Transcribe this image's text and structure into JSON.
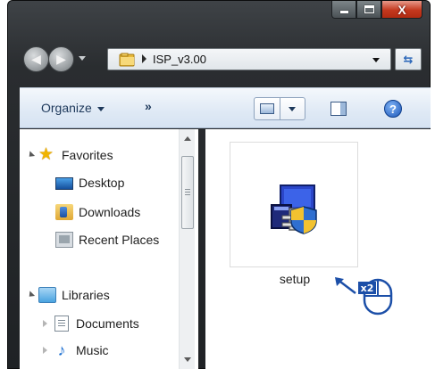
{
  "window": {
    "caption_buttons": {
      "minimize_icon": "minimize-icon",
      "maximize_icon": "maximize-icon",
      "close_glyph": "X"
    }
  },
  "address_bar": {
    "path": "ISP_v3.00",
    "folder_icon": "folder-icon",
    "refresh_icon": "refresh-icon"
  },
  "toolbar": {
    "organize_label": "Organize",
    "more_label": "»",
    "help_glyph": "?"
  },
  "navigation": {
    "favorites": {
      "label": "Favorites",
      "items": [
        {
          "label": "Desktop",
          "icon": "desktop-icon"
        },
        {
          "label": "Downloads",
          "icon": "downloads-icon"
        },
        {
          "label": "Recent Places",
          "icon": "recent-places-icon"
        }
      ]
    },
    "libraries": {
      "label": "Libraries",
      "items": [
        {
          "label": "Documents",
          "icon": "documents-icon"
        },
        {
          "label": "Music",
          "icon": "music-icon"
        }
      ]
    }
  },
  "content": {
    "files": [
      {
        "name": "setup",
        "icon": "installer-icon"
      }
    ]
  },
  "annotation": {
    "double_click_label": "x2"
  }
}
